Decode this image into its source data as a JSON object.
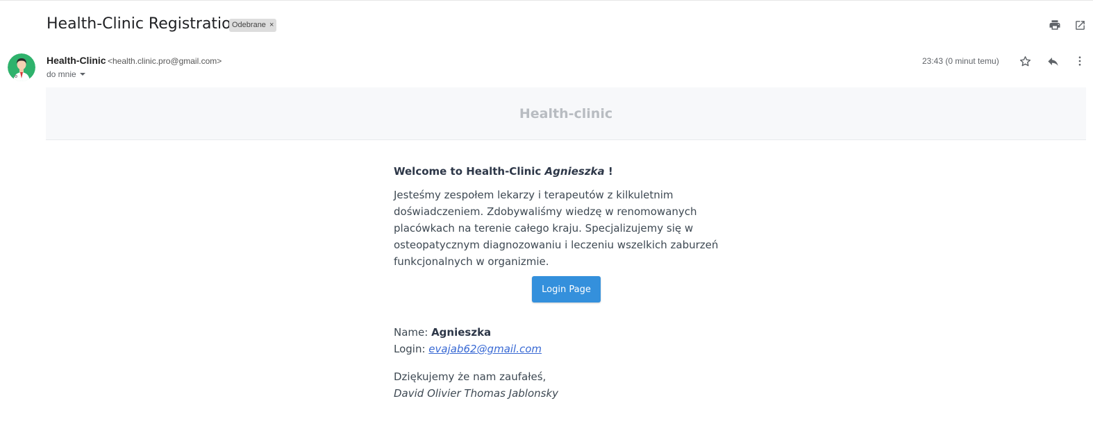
{
  "email": {
    "subject": "Health-Clinic Registration",
    "label": "Odebrane",
    "label_remove": "×",
    "sender_name": "Health-Clinic",
    "sender_email": "<health.clinic.pro@gmail.com>",
    "to": "do mnie",
    "timestamp": "23:43 (0 minut temu)"
  },
  "icons": {
    "print": "print-icon",
    "popout": "open-in-new-window-icon",
    "star": "star-icon",
    "reply": "reply-icon",
    "more": "more-vertical-icon",
    "dropdown": "caret-down-icon",
    "avatar": "doctor-avatar-icon"
  },
  "colors": {
    "avatar_bg": "#2fb26c",
    "button": "#3490dc",
    "link": "#3869d4",
    "banner_bg": "#f7f8fa",
    "banner_text": "#b8bcc1"
  },
  "body": {
    "brand": "Health-clinic",
    "welcome_prefix": "Welcome to Health-Clinic ",
    "welcome_name": "Agnieszka",
    "welcome_suffix": " !",
    "paragraph": "Jesteśmy zespołem lekarzy i terapeutów z kilkuletnim doświadczeniem. Zdobywaliśmy wiedzę w renomowanych placówkach na terenie całego kraju. Specjalizujemy się w osteopatycznym diagnozowaniu i leczeniu wszelkich zaburzeń funkcjonalnych w organizmie.",
    "button_label": "Login Page",
    "name_label": "Name: ",
    "name_value": "Agnieszka",
    "login_label": "Login: ",
    "login_value": "evajab62@gmail.com",
    "thanks": "Dziękujemy że nam zaufałeś,",
    "signature": "David Olivier Thomas Jablonsky"
  }
}
